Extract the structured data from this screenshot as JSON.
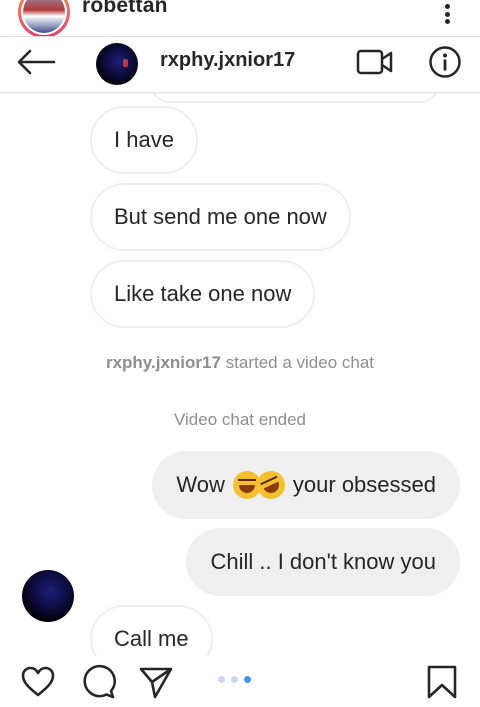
{
  "post": {
    "username": "robettan"
  },
  "dm": {
    "username": "rxphy.jxnior17",
    "messages": [
      {
        "side": "in",
        "text": "I have"
      },
      {
        "side": "in",
        "text": "But send me one now"
      },
      {
        "side": "in",
        "text": "Like take one now"
      }
    ],
    "system": {
      "video_started_user": "rxphy.jxnior17",
      "video_started_text": "started a video chat",
      "video_ended": "Video chat ended"
    },
    "outgoing": [
      {
        "prefix": "Wow",
        "emoji": [
          "joy-emoji",
          "rofl-emoji"
        ],
        "suffix": "your obsessed"
      },
      {
        "text": "Chill .. I don't know you"
      }
    ],
    "last_incoming": "Call me"
  },
  "carousel": {
    "count": 3,
    "active_index": 2
  },
  "colors": {
    "accent": "#3897f0",
    "bubble_out": "#efefef",
    "text": "#262626",
    "muted": "#8e8e8e"
  }
}
